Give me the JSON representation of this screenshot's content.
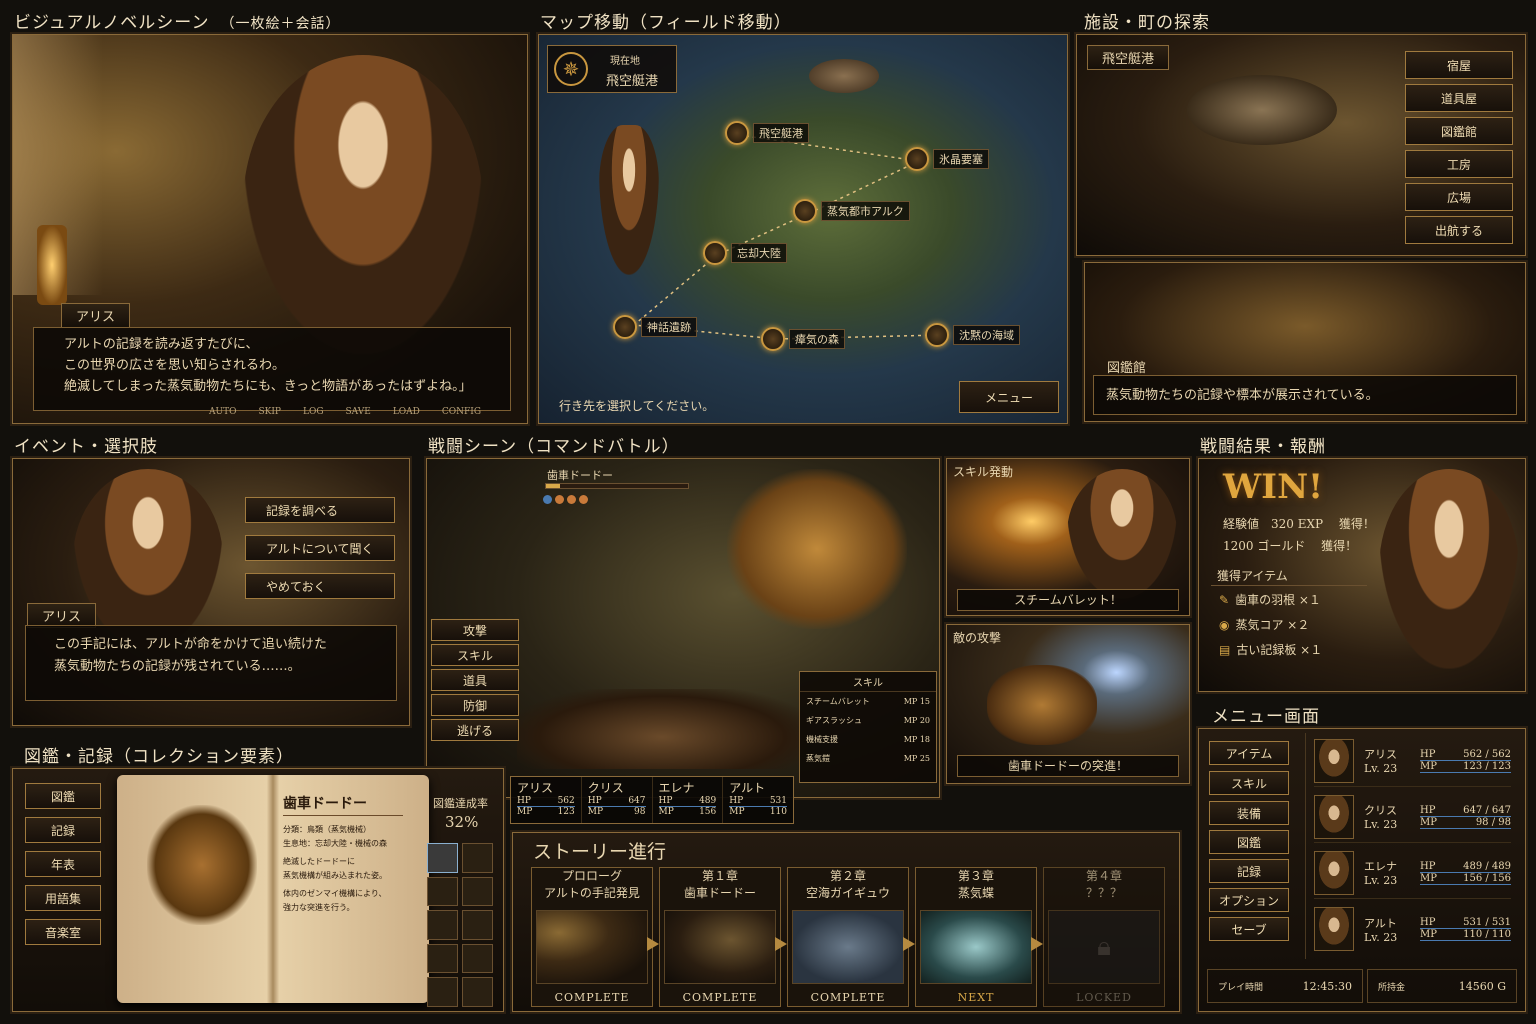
{
  "sections": {
    "vn": {
      "title": "ビジュアルノベルシーン",
      "sub": "（一枚絵＋会話）"
    },
    "map": {
      "title": "マップ移動（フィールド移動）"
    },
    "town": {
      "title": "施設・町の探索"
    },
    "event": {
      "title": "イベント・選択肢"
    },
    "battle": {
      "title": "戦闘シーン（コマンドバトル）"
    },
    "result": {
      "title": "戦闘結果・報酬"
    },
    "zukan": {
      "title": "図鑑・記録（コレクション要素）"
    },
    "story": {
      "title": "ストーリー進行"
    },
    "menu": {
      "title": "メニュー画面"
    }
  },
  "vn": {
    "speaker": "アリス",
    "lines": [
      "アルトの記録を読み返すたびに、",
      "この世界の広さを思い知らされるわ。",
      "絶滅してしまった蒸気動物たちにも、きっと物語があったはずよね。」"
    ],
    "controls": [
      "AUTO",
      "SKIP",
      "LOG",
      "SAVE",
      "LOAD",
      "CONFIG"
    ]
  },
  "map": {
    "current_label": "現在地",
    "current": "飛空艇港",
    "nodes": [
      "飛空艇港",
      "氷晶要塞",
      "蒸気都市アルク",
      "忘却大陸",
      "神話遺跡",
      "瘴気の森",
      "沈黙の海域"
    ],
    "prompt": "行き先を選択してください。",
    "menu_button": "メニュー"
  },
  "town": {
    "location": "飛空艇港",
    "buttons": [
      "宿屋",
      "道具屋",
      "図鑑館",
      "工房",
      "広場",
      "出航する"
    ],
    "sub_name": "図鑑館",
    "sub_text": "蒸気動物たちの記録や標本が展示されている。"
  },
  "event": {
    "choices": [
      "記録を調べる",
      "アルトについて聞く",
      "やめておく"
    ],
    "speaker": "アリス",
    "lines": [
      "この手記には、アルトが命をかけて追い続けた",
      "蒸気動物たちの記録が残されている……。"
    ]
  },
  "battle": {
    "enemy": "歯車ドードー",
    "commands": [
      "攻撃",
      "スキル",
      "道具",
      "防御",
      "逃げる"
    ],
    "skill_header": "スキル",
    "skills": [
      {
        "name": "スチームバレット",
        "mp": "MP 15"
      },
      {
        "name": "ギアスラッシュ",
        "mp": "MP 20"
      },
      {
        "name": "機械支援",
        "mp": "MP 18"
      },
      {
        "name": "蒸気鎧",
        "mp": "MP 25"
      }
    ],
    "party": [
      {
        "name": "アリス",
        "hp": "562",
        "mp": "123"
      },
      {
        "name": "クリス",
        "hp": "647",
        "mp": "98"
      },
      {
        "name": "エレナ",
        "hp": "489",
        "mp": "156"
      },
      {
        "name": "アルト",
        "hp": "531",
        "mp": "110"
      }
    ],
    "hp_label": "HP",
    "mp_label": "MP",
    "skill_panel": {
      "title": "スキル発動",
      "caption": "スチームバレット！"
    },
    "enemy_panel": {
      "title": "敵の攻撃",
      "caption": "歯車ドードーの突進！"
    }
  },
  "result": {
    "win": "WIN!",
    "exp_line": "経験値　320 EXP　 獲得！",
    "gold_line": "1200 ゴールド　 獲得！",
    "items_label": "獲得アイテム",
    "items": [
      "歯車の羽根 ×１",
      "蒸気コア ×２",
      "古い記録板 ×１"
    ]
  },
  "zukan": {
    "tabs": [
      "図鑑",
      "記録",
      "年表",
      "用語集",
      "音楽室"
    ],
    "entry_title": "歯車ドードー",
    "lines": [
      "分類：鳥類（蒸気機械）",
      "生息地：忘却大陸・機械の森",
      "絶滅したドードーに",
      "蒸気機構が組み込まれた姿。",
      "体内のゼンマイ機構により、",
      "強力な突進を行う。"
    ],
    "rate_label": "図鑑達成率",
    "rate": "32%"
  },
  "story": {
    "chapters": [
      {
        "title": "プロローグ",
        "sub": "アルトの手記発見",
        "status": "COMPLETE"
      },
      {
        "title": "第１章",
        "sub": "歯車ドードー",
        "status": "COMPLETE"
      },
      {
        "title": "第２章",
        "sub": "空海ガイギュウ",
        "status": "COMPLETE"
      },
      {
        "title": "第３章",
        "sub": "蒸気蝶",
        "status": "NEXT"
      },
      {
        "title": "第４章",
        "sub": "？？？",
        "status": "LOCKED"
      }
    ]
  },
  "menu": {
    "items": [
      "アイテム",
      "スキル",
      "装備",
      "図鑑",
      "記録",
      "オプション",
      "セーブ"
    ],
    "party": [
      {
        "name": "アリス",
        "lv": "Lv. 23",
        "hp": "562 / 562",
        "mp": "123 / 123"
      },
      {
        "name": "クリス",
        "lv": "Lv. 23",
        "hp": "647 / 647",
        "mp": "98 / 98"
      },
      {
        "name": "エレナ",
        "lv": "Lv. 23",
        "hp": "489 / 489",
        "mp": "156 / 156"
      },
      {
        "name": "アルト",
        "lv": "Lv. 23",
        "hp": "531 / 531",
        "mp": "110 / 110"
      }
    ],
    "hp_label": "HP",
    "mp_label": "MP",
    "playtime_label": "プレイ時間",
    "playtime": "12:45:30",
    "money_label": "所持金",
    "money": "14560 G"
  },
  "colors": {
    "gold": "#d9a94a",
    "frame": "#8a6a3a",
    "bg": "#12100c",
    "hp_line": "#4a7ab0"
  }
}
